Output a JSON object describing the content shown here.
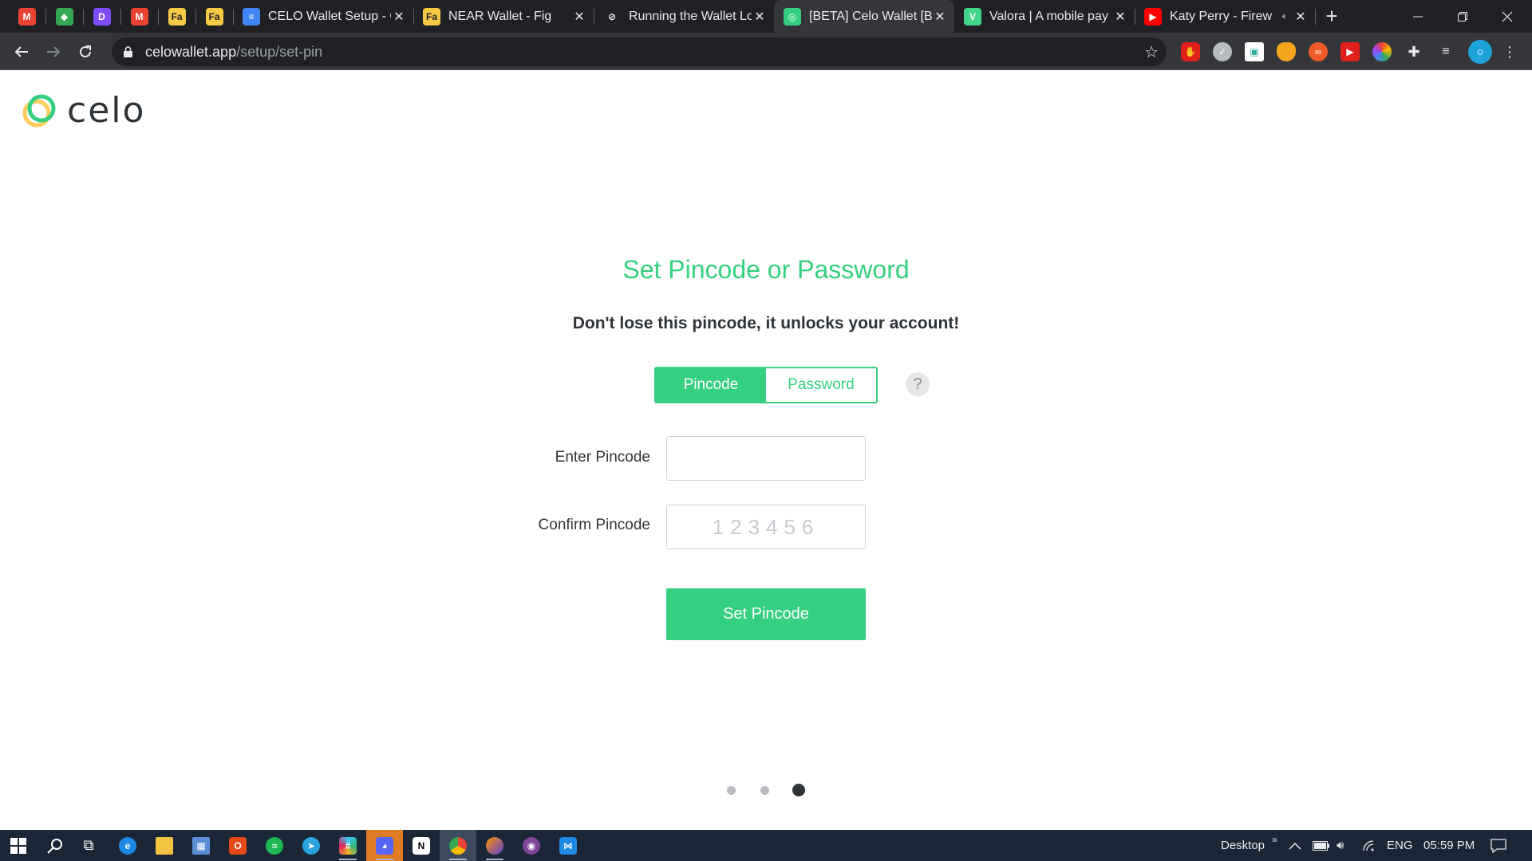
{
  "browser": {
    "tabs": [
      {
        "title": "",
        "favicon": "gmail-icon",
        "color": "#ea4335",
        "glyph": "M",
        "pinned": true
      },
      {
        "title": "",
        "favicon": "diamond-app-icon",
        "color": "#34a853",
        "glyph": "◆",
        "pinned": true
      },
      {
        "title": "",
        "favicon": "d-app-icon",
        "color": "#7b4dff",
        "glyph": "D",
        "pinned": true
      },
      {
        "title": "",
        "favicon": "gmail-icon",
        "color": "#ea4335",
        "glyph": "M",
        "pinned": true
      },
      {
        "title": "",
        "favicon": "fa-app-icon",
        "color": "#f6c945",
        "glyph": "Fa",
        "pinned": true
      },
      {
        "title": "",
        "favicon": "fa-app-icon",
        "color": "#f6c945",
        "glyph": "Fa",
        "pinned": true
      },
      {
        "title": "CELO Wallet Setup - G",
        "favicon": "google-docs-icon",
        "color": "#4285f4",
        "glyph": "≡",
        "pinned": false
      },
      {
        "title": "NEAR Wallet - Fig",
        "favicon": "fa-app-icon",
        "color": "#f6c945",
        "glyph": "Fa",
        "pinned": false
      },
      {
        "title": "Running the Wallet Lo",
        "favicon": "link-icon",
        "color": "#5f6368",
        "glyph": "⊘",
        "pinned": false
      },
      {
        "title": "[BETA] Celo Wallet [BE",
        "favicon": "celo-icon",
        "color": "#35d07f",
        "glyph": "◎",
        "pinned": false,
        "active": true
      },
      {
        "title": "Valora | A mobile pay",
        "favicon": "valora-icon",
        "color": "#42d689",
        "glyph": "V",
        "pinned": false
      },
      {
        "title": "Katy Perry - Firew",
        "favicon": "youtube-icon",
        "color": "#ff0000",
        "glyph": "▶",
        "pinned": false,
        "muted": true
      }
    ],
    "url_host": "celowallet.app",
    "url_path": "/setup/set-pin"
  },
  "page": {
    "logo_text": "celo",
    "title": "Set Pincode or Password",
    "warning": "Don't lose this pincode, it unlocks your account!",
    "toggle": {
      "pincode": "Pincode",
      "password": "Password",
      "selected": "pincode"
    },
    "help": "?",
    "enter_label": "Enter Pincode",
    "enter_value": "",
    "confirm_label": "Confirm Pincode",
    "confirm_placeholder": "123456",
    "submit": "Set Pincode",
    "steps": {
      "total": 3,
      "current": 3
    }
  },
  "colors": {
    "accent": "#35d07f",
    "logo_gold": "#fbcc5c",
    "text": "#2e3338"
  },
  "taskbar": {
    "tray_desktop": "Desktop",
    "tray_lang": "ENG",
    "tray_time": "05:59 PM"
  }
}
